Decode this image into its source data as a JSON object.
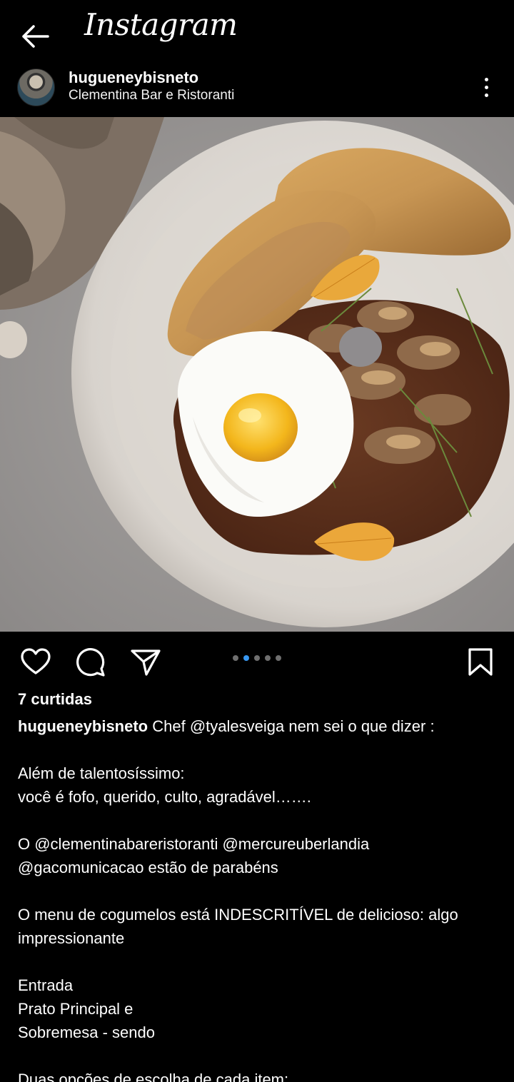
{
  "app": {
    "title": "Instagram"
  },
  "post": {
    "username": "hugueneybisneto",
    "location": "Clementina Bar e Ristoranti",
    "likes": "7 curtidas",
    "carousel": {
      "count": 5,
      "active": 1
    },
    "caption_lines": [
      {
        "user": "hugueneybisneto",
        "text": " Chef @tyalesveiga nem sei o que dizer :"
      },
      {
        "user": "",
        "text": ""
      },
      {
        "user": "",
        "text": "Além de talentosíssimo:"
      },
      {
        "user": "",
        "text": "você é fofo, querido, culto, agradável……."
      },
      {
        "user": "",
        "text": ""
      },
      {
        "user": "",
        "text": "O @clementinabareristoranti @mercureuberlandia"
      },
      {
        "user": "",
        "text": "@gacomunicacao estão de parabéns"
      },
      {
        "user": "",
        "text": ""
      },
      {
        "user": "",
        "text": "O menu de cogumelos está INDESCRITÍVEL de delicioso: algo"
      },
      {
        "user": "",
        "text": "impressionante"
      },
      {
        "user": "",
        "text": ""
      },
      {
        "user": "",
        "text": "Entrada"
      },
      {
        "user": "",
        "text": "Prato Principal e"
      },
      {
        "user": "",
        "text": "Sobremesa - sendo"
      },
      {
        "user": "",
        "text": ""
      },
      {
        "user": "",
        "text": "Duas opções de escolha de cada item:"
      }
    ]
  },
  "icons": {
    "back": "arrow-left-icon",
    "more": "more-vertical-icon",
    "like": "heart-icon",
    "comment": "comment-icon",
    "share": "send-icon",
    "save": "bookmark-icon"
  },
  "colors": {
    "background": "#000000",
    "text": "#ffffff",
    "carousel_active": "#3897f0",
    "carousel_inactive": "#6f6f6f"
  }
}
